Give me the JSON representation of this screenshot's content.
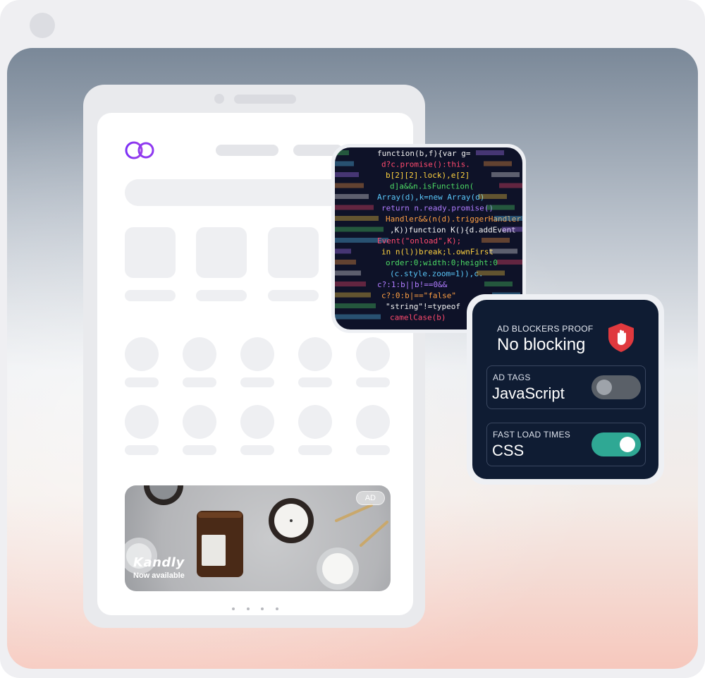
{
  "colors": {
    "panel_background": "#0f1c33",
    "toggle_on": "#2fa894",
    "toggle_off": "#5a6068",
    "shield": "#e0393e",
    "logo_primary": "#7b2ff7"
  },
  "ad": {
    "badge": "AD",
    "brand": "Kandly",
    "subtitle": "Now available",
    "carousel_dots": 4,
    "active_dot": 1
  },
  "panel": {
    "kicker": "AD BLOCKERS PROOF",
    "title": "No blocking",
    "icon": "shield-hand-icon",
    "rows": [
      {
        "kicker": "AD TAGS",
        "value": "JavaScript",
        "toggle_on": false
      },
      {
        "kicker": "FAST LOAD TIMES",
        "value": "CSS",
        "toggle_on": true
      }
    ]
  },
  "code_lines": [
    "function(b,f){var g=",
    "d?c.promise():this.",
    "b[2][2].lock),e[2]",
    "d]a&&n.isFunction(",
    "Array(d),k=new Array(d)",
    "return n.ready.promise()",
    "Handler&&(n(d).triggerHandler",
    ",K))function K(){d.addEvent",
    "Event(\"onload\",K);",
    "in n(l))break;l.ownFirst",
    "order:0;width:0;height:0",
    "(c.style.zoom=1)),c.",
    "c?:1:b||b!==0&&",
    "c?:0:b|==\"false\"",
    "\"string\"!=typeof",
    "camelCase(b)"
  ]
}
